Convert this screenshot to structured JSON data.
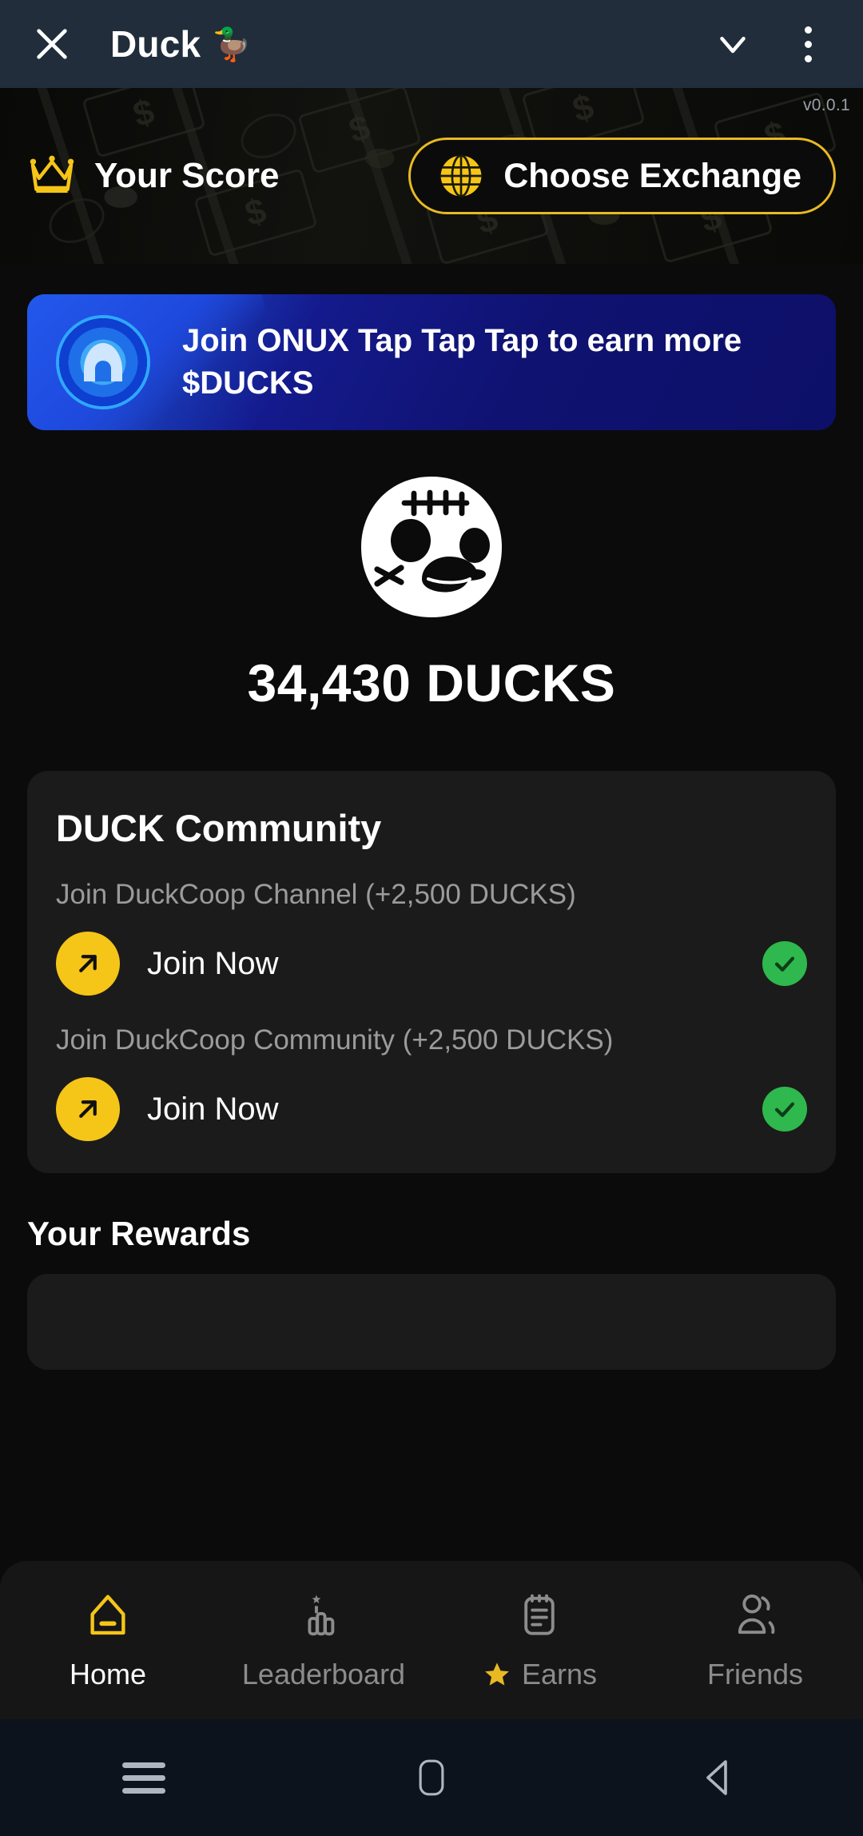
{
  "header": {
    "close_icon": "close-icon",
    "title": "Duck",
    "title_emoji": "🦆",
    "chevron_icon": "chevron-down-icon",
    "menu_icon": "more-vertical-icon"
  },
  "score_bar": {
    "crown_icon": "crown-icon",
    "label": "Your Score",
    "version": "v0.0.1",
    "exchange_button": {
      "globe_icon": "globe-icon",
      "label": "Choose Exchange",
      "border_color": "#e8b923"
    }
  },
  "promo_banner": {
    "logo_icon": "onux-logo-icon",
    "text": "Join ONUX Tap Tap Tap to earn more $DUCKS",
    "background_color": "#141a8c"
  },
  "balance": {
    "mascot_icon": "duck-skull-mascot-icon",
    "amount": "34,430 DUCKS"
  },
  "community_card": {
    "title": "DUCK Community",
    "tasks": [
      {
        "label": "Join DuckCoop Channel (+2,500 DUCKS)",
        "action_label": "Join Now",
        "action_icon": "arrow-up-right-icon",
        "status_icon": "check-circle-icon",
        "completed": true
      },
      {
        "label": "Join DuckCoop Community (+2,500 DUCKS)",
        "action_label": "Join Now",
        "action_icon": "arrow-up-right-icon",
        "status_icon": "check-circle-icon",
        "completed": true
      }
    ],
    "accent_color": "#f5c518",
    "check_color": "#2fb84d"
  },
  "rewards": {
    "title": "Your Rewards"
  },
  "tabbar": {
    "tabs": [
      {
        "label": "Home",
        "icon": "home-icon",
        "active": true
      },
      {
        "label": "Leaderboard",
        "icon": "podium-star-icon",
        "active": false
      },
      {
        "label": "Earns",
        "icon": "clipboard-icon",
        "active": false,
        "badge_icon": "star-icon"
      },
      {
        "label": "Friends",
        "icon": "people-icon",
        "active": false
      }
    ],
    "active_color": "#f5c518"
  },
  "system_nav": {
    "recents_icon": "menu-icon",
    "home_icon": "square-icon",
    "back_icon": "triangle-back-icon"
  }
}
